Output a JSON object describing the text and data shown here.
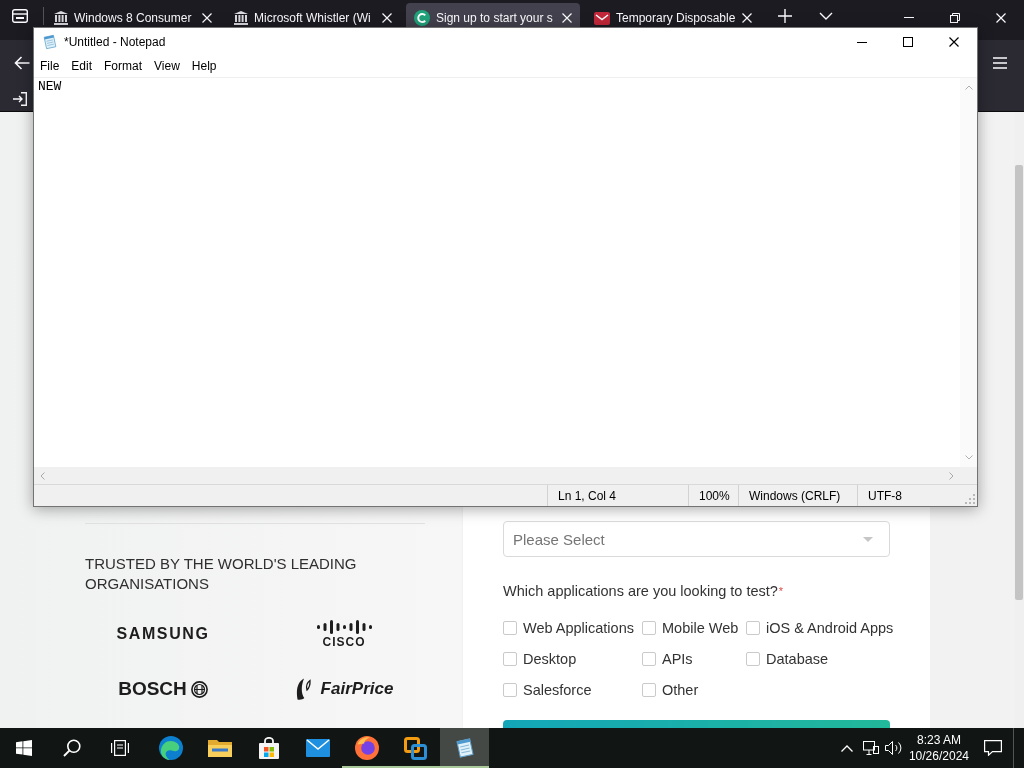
{
  "browser": {
    "tabs": [
      {
        "title": "Windows 8 Consumer",
        "kind": "columns",
        "selected": false
      },
      {
        "title": "Microsoft Whistler (Wi",
        "kind": "columns",
        "selected": false
      },
      {
        "title": "Sign up to start your s",
        "kind": "round",
        "selected": true
      },
      {
        "title": "Temporary Disposable",
        "kind": "mail",
        "selected": false
      }
    ]
  },
  "notepad": {
    "title": "*Untitled - Notepad",
    "menu": [
      "File",
      "Edit",
      "Format",
      "View",
      "Help"
    ],
    "text": "NEW",
    "status": [
      "Ln 1, Col 4",
      "100%",
      "Windows (CRLF)",
      "UTF-8"
    ]
  },
  "page": {
    "heading": "TRUSTED BY THE WORLD'S LEADING ORGANISATIONS",
    "logos": [
      {
        "kind": "plain",
        "text": "SAMSUNG"
      },
      {
        "kind": "bars",
        "text": "CISCO"
      },
      {
        "kind": "ring",
        "text": "BOSCH"
      },
      {
        "kind": "leaf",
        "text": "FairPrice"
      }
    ],
    "form": {
      "select": {
        "placeholder": "Please Select"
      },
      "question": {
        "label": "Which applications are you looking to test?",
        "required_mark": "*"
      },
      "options": [
        {
          "label": "Web Applications",
          "checked": false
        },
        {
          "label": "Mobile Web",
          "checked": false
        },
        {
          "label": "iOS & Android Apps",
          "checked": false
        },
        {
          "label": "Desktop",
          "checked": false
        },
        {
          "label": "APIs",
          "checked": false
        },
        {
          "label": "Database",
          "checked": false
        },
        {
          "label": "Salesforce",
          "checked": false
        },
        {
          "label": "Other",
          "checked": false
        }
      ]
    }
  },
  "taskbar": {
    "apps": [
      {
        "kind": "swirl",
        "running": false,
        "selected": false
      },
      {
        "kind": "folder",
        "running": false,
        "selected": false
      },
      {
        "kind": "bag",
        "running": false,
        "selected": false
      },
      {
        "kind": "envelope",
        "running": false,
        "selected": false
      },
      {
        "kind": "fox",
        "running": true,
        "selected": false
      },
      {
        "kind": "squares",
        "running": true,
        "selected": false
      },
      {
        "kind": "notepad",
        "running": true,
        "selected": true
      }
    ],
    "time": "8:23 AM",
    "date": "10/26/2024"
  }
}
